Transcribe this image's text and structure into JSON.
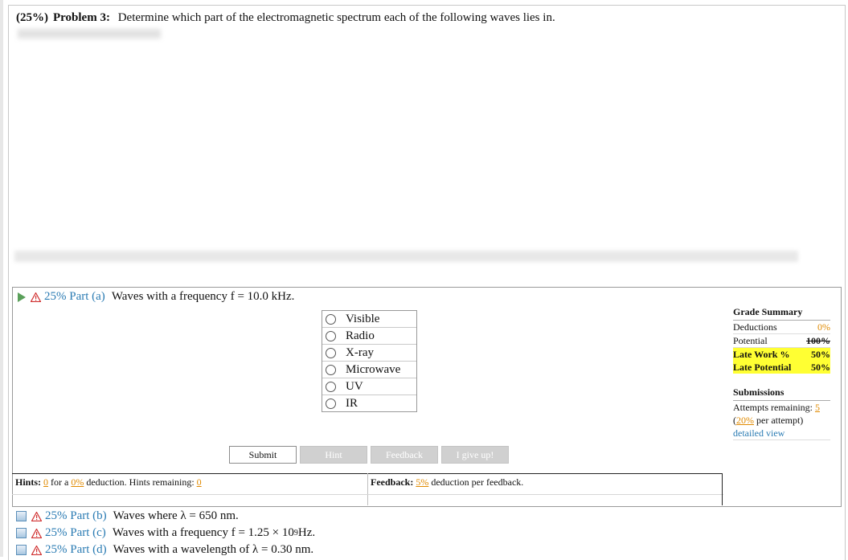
{
  "problem": {
    "weight": "(25%)",
    "label": "Problem 3:",
    "text": "Determine which part of the electromagnetic spectrum each of the following waves lies in."
  },
  "part_a": {
    "percent_part": "25% Part (a)",
    "question": "Waves with a frequency f = 10.0 kHz.",
    "options": [
      "Visible",
      "Radio",
      "X-ray",
      "Microwave",
      "UV",
      "IR"
    ]
  },
  "grade_summary": {
    "title": "Grade Summary",
    "deductions_label": "Deductions",
    "deductions_value": "0%",
    "potential_label": "Potential",
    "potential_value": "100%",
    "late_work_label": "Late Work %",
    "late_work_value": "50%",
    "late_potential_label": "Late Potential",
    "late_potential_value": "50%"
  },
  "submissions": {
    "title": "Submissions",
    "attempts_label": "Attempts remaining:",
    "attempts_value": "5",
    "per_attempt_pct": "20%",
    "per_attempt_text": "per attempt)",
    "open_paren": "(",
    "detailed_view": "detailed view"
  },
  "buttons": {
    "submit": "Submit",
    "hint": "Hint",
    "feedback": "Feedback",
    "give_up": "I give up!"
  },
  "hints": {
    "label": "Hints:",
    "count": "0",
    "for_a": "for a",
    "pct": "0%",
    "deduction_text": "deduction. Hints remaining:",
    "remaining": "0"
  },
  "feedback": {
    "label": "Feedback:",
    "pct": "5%",
    "text": "deduction per feedback."
  },
  "other_parts": [
    {
      "percent_part": "25% Part (b)",
      "question": "Waves where λ = 650 nm."
    },
    {
      "percent_part": "25% Part (c)",
      "question": "Waves with a frequency f = 1.25 × 10",
      "sup": "9",
      "tail": " Hz."
    },
    {
      "percent_part": "25% Part (d)",
      "question": "Waves with a wavelength of λ = 0.30 nm."
    }
  ]
}
